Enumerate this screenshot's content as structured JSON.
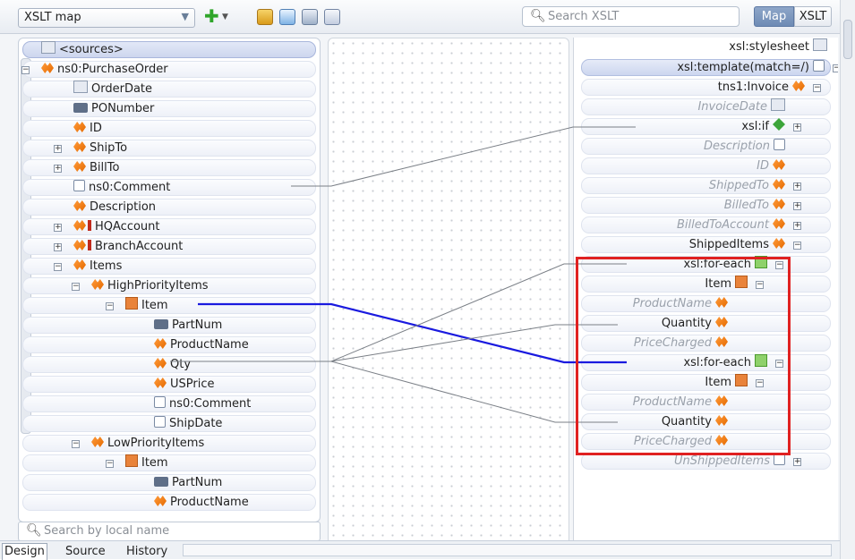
{
  "toolbar": {
    "map_select": "XSLT map",
    "search_placeholder": "Search XSLT",
    "tab_map": "Map",
    "tab_xslt": "XSLT"
  },
  "source_tree": [
    {
      "label": "<sources>",
      "icon": "sources-icon"
    },
    {
      "label": "ns0:PurchaseOrder",
      "icon": "element-icon"
    },
    {
      "label": "OrderDate",
      "icon": "xsd-type-icon"
    },
    {
      "label": "PONumber",
      "icon": "attribute-icon"
    },
    {
      "label": "ID",
      "icon": "element-icon"
    },
    {
      "label": "ShipTo",
      "icon": "element-icon"
    },
    {
      "label": "BillTo",
      "icon": "element-icon"
    },
    {
      "label": "ns0:Comment",
      "icon": "comment-icon"
    },
    {
      "label": "Description",
      "icon": "element-icon"
    },
    {
      "label": "HQAccount",
      "icon": "element-icon"
    },
    {
      "label": "BranchAccount",
      "icon": "element-icon"
    },
    {
      "label": "Items",
      "icon": "element-icon"
    },
    {
      "label": "HighPriorityItems",
      "icon": "element-icon"
    },
    {
      "label": "Item",
      "icon": "repeating-element-icon"
    },
    {
      "label": "PartNum",
      "icon": "attribute-icon"
    },
    {
      "label": "ProductName",
      "icon": "element-icon"
    },
    {
      "label": "Qty",
      "icon": "element-icon"
    },
    {
      "label": "USPrice",
      "icon": "element-icon"
    },
    {
      "label": "ns0:Comment",
      "icon": "comment-icon"
    },
    {
      "label": "ShipDate",
      "icon": "comment-icon"
    },
    {
      "label": "LowPriorityItems",
      "icon": "element-icon"
    },
    {
      "label": "Item",
      "icon": "repeating-element-icon"
    },
    {
      "label": "PartNum",
      "icon": "attribute-icon"
    },
    {
      "label": "ProductName",
      "icon": "element-icon"
    }
  ],
  "target_tree": [
    {
      "label": "xsl:stylesheet",
      "style": "normal"
    },
    {
      "label": "xsl:template(match=/)",
      "style": "header"
    },
    {
      "label": "tns1:Invoice",
      "style": "normal"
    },
    {
      "label": "InvoiceDate",
      "style": "dim"
    },
    {
      "label": "xsl:if",
      "style": "normal"
    },
    {
      "label": "Description",
      "style": "dim"
    },
    {
      "label": "ID",
      "style": "dim"
    },
    {
      "label": "ShippedTo",
      "style": "dim"
    },
    {
      "label": "BilledTo",
      "style": "dim"
    },
    {
      "label": "BilledToAccount",
      "style": "dim"
    },
    {
      "label": "ShippedItems",
      "style": "normal"
    },
    {
      "label": "xsl:for-each",
      "style": "normal"
    },
    {
      "label": "Item",
      "style": "normal"
    },
    {
      "label": "ProductName",
      "style": "dim"
    },
    {
      "label": "Quantity",
      "style": "normal"
    },
    {
      "label": "PriceCharged",
      "style": "dim"
    },
    {
      "label": "xsl:for-each",
      "style": "normal"
    },
    {
      "label": "Item",
      "style": "normal"
    },
    {
      "label": "ProductName",
      "style": "dim"
    },
    {
      "label": "Quantity",
      "style": "normal"
    },
    {
      "label": "PriceCharged",
      "style": "dim"
    },
    {
      "label": "UnShippedItems",
      "style": "dim"
    }
  ],
  "footer": {
    "local_search_placeholder": "Search by local name",
    "tabs": [
      "Design",
      "Source",
      "History"
    ]
  },
  "colors": {
    "highlight_box": "#e02121",
    "selected_wire": "#1a1adf",
    "wire": "#7a7f86"
  }
}
